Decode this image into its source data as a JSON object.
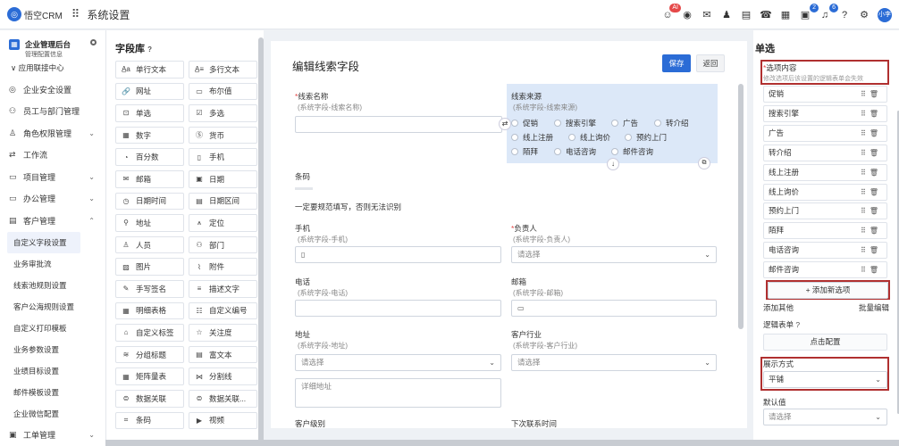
{
  "topbar": {
    "logo_text": "悟空CRM",
    "title": "系统设置",
    "avatar": "小李",
    "badges": {
      "ai": "AI",
      "notice": "2",
      "msg": "6"
    }
  },
  "sidebar": {
    "enterprise": "企业管理后台",
    "enterprise_sub": "管理配置信息",
    "app_center": "应用联接中心",
    "items": [
      {
        "label": "企业安全设置",
        "chev": ""
      },
      {
        "label": "员工与部门管理",
        "chev": ""
      },
      {
        "label": "角色权限管理",
        "chev": "⌄"
      },
      {
        "label": "工作流",
        "chev": ""
      },
      {
        "label": "项目管理",
        "chev": "⌄"
      },
      {
        "label": "办公管理",
        "chev": "⌄"
      },
      {
        "label": "客户管理",
        "chev": "⌃"
      }
    ],
    "subs": [
      "自定义字段设置",
      "业务审批流",
      "线索池规则设置",
      "客户公海规则设置",
      "自定义打印模板",
      "业务参数设置",
      "业绩目标设置",
      "邮件模板设置",
      "企业微信配置"
    ],
    "bottom": "工单管理"
  },
  "library": {
    "title": "字段库",
    "fields": [
      {
        "icon": "A̲a",
        "label": "单行文本"
      },
      {
        "icon": "A̲≡",
        "label": "多行文本"
      },
      {
        "icon": "🔗",
        "label": "网址"
      },
      {
        "icon": "▭",
        "label": "布尔值"
      },
      {
        "icon": "⊡",
        "label": "单选"
      },
      {
        "icon": "☑",
        "label": "多选"
      },
      {
        "icon": "▦",
        "label": "数字"
      },
      {
        "icon": "Ⓢ",
        "label": "货币"
      },
      {
        "icon": "◔",
        "label": "百分数"
      },
      {
        "icon": "▯",
        "label": "手机"
      },
      {
        "icon": "✉",
        "label": "邮箱"
      },
      {
        "icon": "▣",
        "label": "日期"
      },
      {
        "icon": "◷",
        "label": "日期时间"
      },
      {
        "icon": "▤",
        "label": "日期区间"
      },
      {
        "icon": "⚲",
        "label": "地址"
      },
      {
        "icon": "⩚",
        "label": "定位"
      },
      {
        "icon": "♙",
        "label": "人员"
      },
      {
        "icon": "⚇",
        "label": "部门"
      },
      {
        "icon": "▨",
        "label": "图片"
      },
      {
        "icon": "⌇",
        "label": "附件"
      },
      {
        "icon": "✎",
        "label": "手写签名"
      },
      {
        "icon": "≡",
        "label": "描述文字"
      },
      {
        "icon": "▦",
        "label": "明细表格"
      },
      {
        "icon": "☷",
        "label": "自定义编号"
      },
      {
        "icon": "⌂",
        "label": "自定义标签"
      },
      {
        "icon": "☆",
        "label": "关注度"
      },
      {
        "icon": "≋",
        "label": "分组标题"
      },
      {
        "icon": "▤",
        "label": "富文本"
      },
      {
        "icon": "▦",
        "label": "矩阵量表"
      },
      {
        "icon": "⋈",
        "label": "分割线"
      },
      {
        "icon": "⊜",
        "label": "数据关联"
      },
      {
        "icon": "⊜",
        "label": "数据关联..."
      },
      {
        "icon": "⌗",
        "label": "条码"
      },
      {
        "icon": "▶",
        "label": "视频"
      }
    ]
  },
  "editor": {
    "title": "编辑线索字段",
    "save": "保存",
    "back": "返回",
    "name_label": "线索名称",
    "name_hint": "(系统字段-线索名称)",
    "source_label": "线索来源",
    "source_hint": "(系统字段-线索来源)",
    "source_options": [
      "促销",
      "搜索引擎",
      "广告",
      "转介绍",
      "线上注册",
      "线上询价",
      "预约上门",
      "陌拜",
      "电话咨询",
      "邮件咨询"
    ],
    "barcode_label": "条码",
    "barcode_note": "一定要规范填写，否则无法识别",
    "phone_label": "手机",
    "phone_hint": "(系统字段-手机)",
    "owner_label": "负责人",
    "owner_hint": "(系统字段-负责人)",
    "owner_placeholder": "请选择",
    "tel_label": "电话",
    "tel_hint": "(系统字段-电话)",
    "email_label": "邮箱",
    "email_hint": "(系统字段-邮箱)",
    "addr_label": "地址",
    "addr_hint": "(系统字段-地址)",
    "addr_placeholder": "请选择",
    "addr_detail": "详细地址",
    "industry_label": "客户行业",
    "industry_hint": "(系统字段-客户行业)",
    "industry_placeholder": "请选择",
    "level_label": "客户级别",
    "next_label": "下次联系时间"
  },
  "panel": {
    "title": "单选",
    "options_label": "选项内容",
    "options_hint": "修改选项后该设置的逻辑表单会失效",
    "options": [
      "促销",
      "搜索引擎",
      "广告",
      "转介绍",
      "线上注册",
      "线上询价",
      "预约上门",
      "陌拜",
      "电话咨询",
      "邮件咨询"
    ],
    "add_option": "+ 添加新选项",
    "add_other": "添加其他",
    "batch_edit": "批量编辑",
    "logic_form": "逻辑表单",
    "click_config": "点击配置",
    "display_label": "展示方式",
    "display_value": "平铺",
    "default_label": "默认值",
    "default_placeholder": "请选择"
  }
}
